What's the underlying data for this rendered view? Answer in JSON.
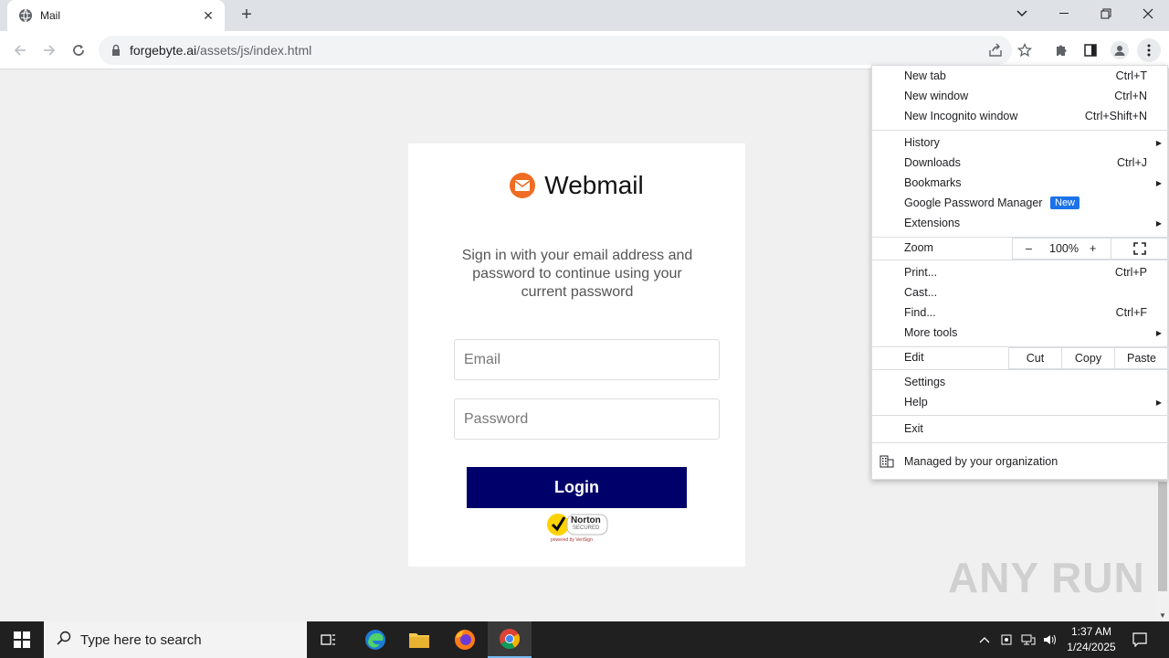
{
  "browser": {
    "tab_title": "Mail",
    "url_host": "forgebyte.ai",
    "url_path": "/assets/js/index.html"
  },
  "login": {
    "brand": "Webmail",
    "description": "Sign in with your email address and password to continue using your current password",
    "email_placeholder": "Email",
    "password_placeholder": "Password",
    "login_label": "Login",
    "badge_line1": "Norton",
    "badge_line2": "SECURED",
    "badge_line3": "powered by VeriSign"
  },
  "menu": {
    "new_tab": "New tab",
    "new_tab_sc": "Ctrl+T",
    "new_window": "New window",
    "new_window_sc": "Ctrl+N",
    "incognito": "New Incognito window",
    "incognito_sc": "Ctrl+Shift+N",
    "history": "History",
    "downloads": "Downloads",
    "downloads_sc": "Ctrl+J",
    "bookmarks": "Bookmarks",
    "password_manager": "Google Password Manager",
    "new_badge": "New",
    "extensions": "Extensions",
    "zoom": "Zoom",
    "zoom_minus": "–",
    "zoom_level": "100%",
    "zoom_plus": "+",
    "print": "Print...",
    "print_sc": "Ctrl+P",
    "cast": "Cast...",
    "find": "Find...",
    "find_sc": "Ctrl+F",
    "more_tools": "More tools",
    "edit": "Edit",
    "cut": "Cut",
    "copy": "Copy",
    "paste": "Paste",
    "settings": "Settings",
    "help": "Help",
    "exit": "Exit",
    "managed": "Managed by your organization"
  },
  "watermark": "ANY RUN",
  "taskbar": {
    "search_placeholder": "Type here to search",
    "time": "1:37 AM",
    "date": "1/24/2025"
  },
  "colors": {
    "login_button": "#00006b",
    "brand_icon": "#ef6c22",
    "new_badge": "#1a73e8"
  }
}
